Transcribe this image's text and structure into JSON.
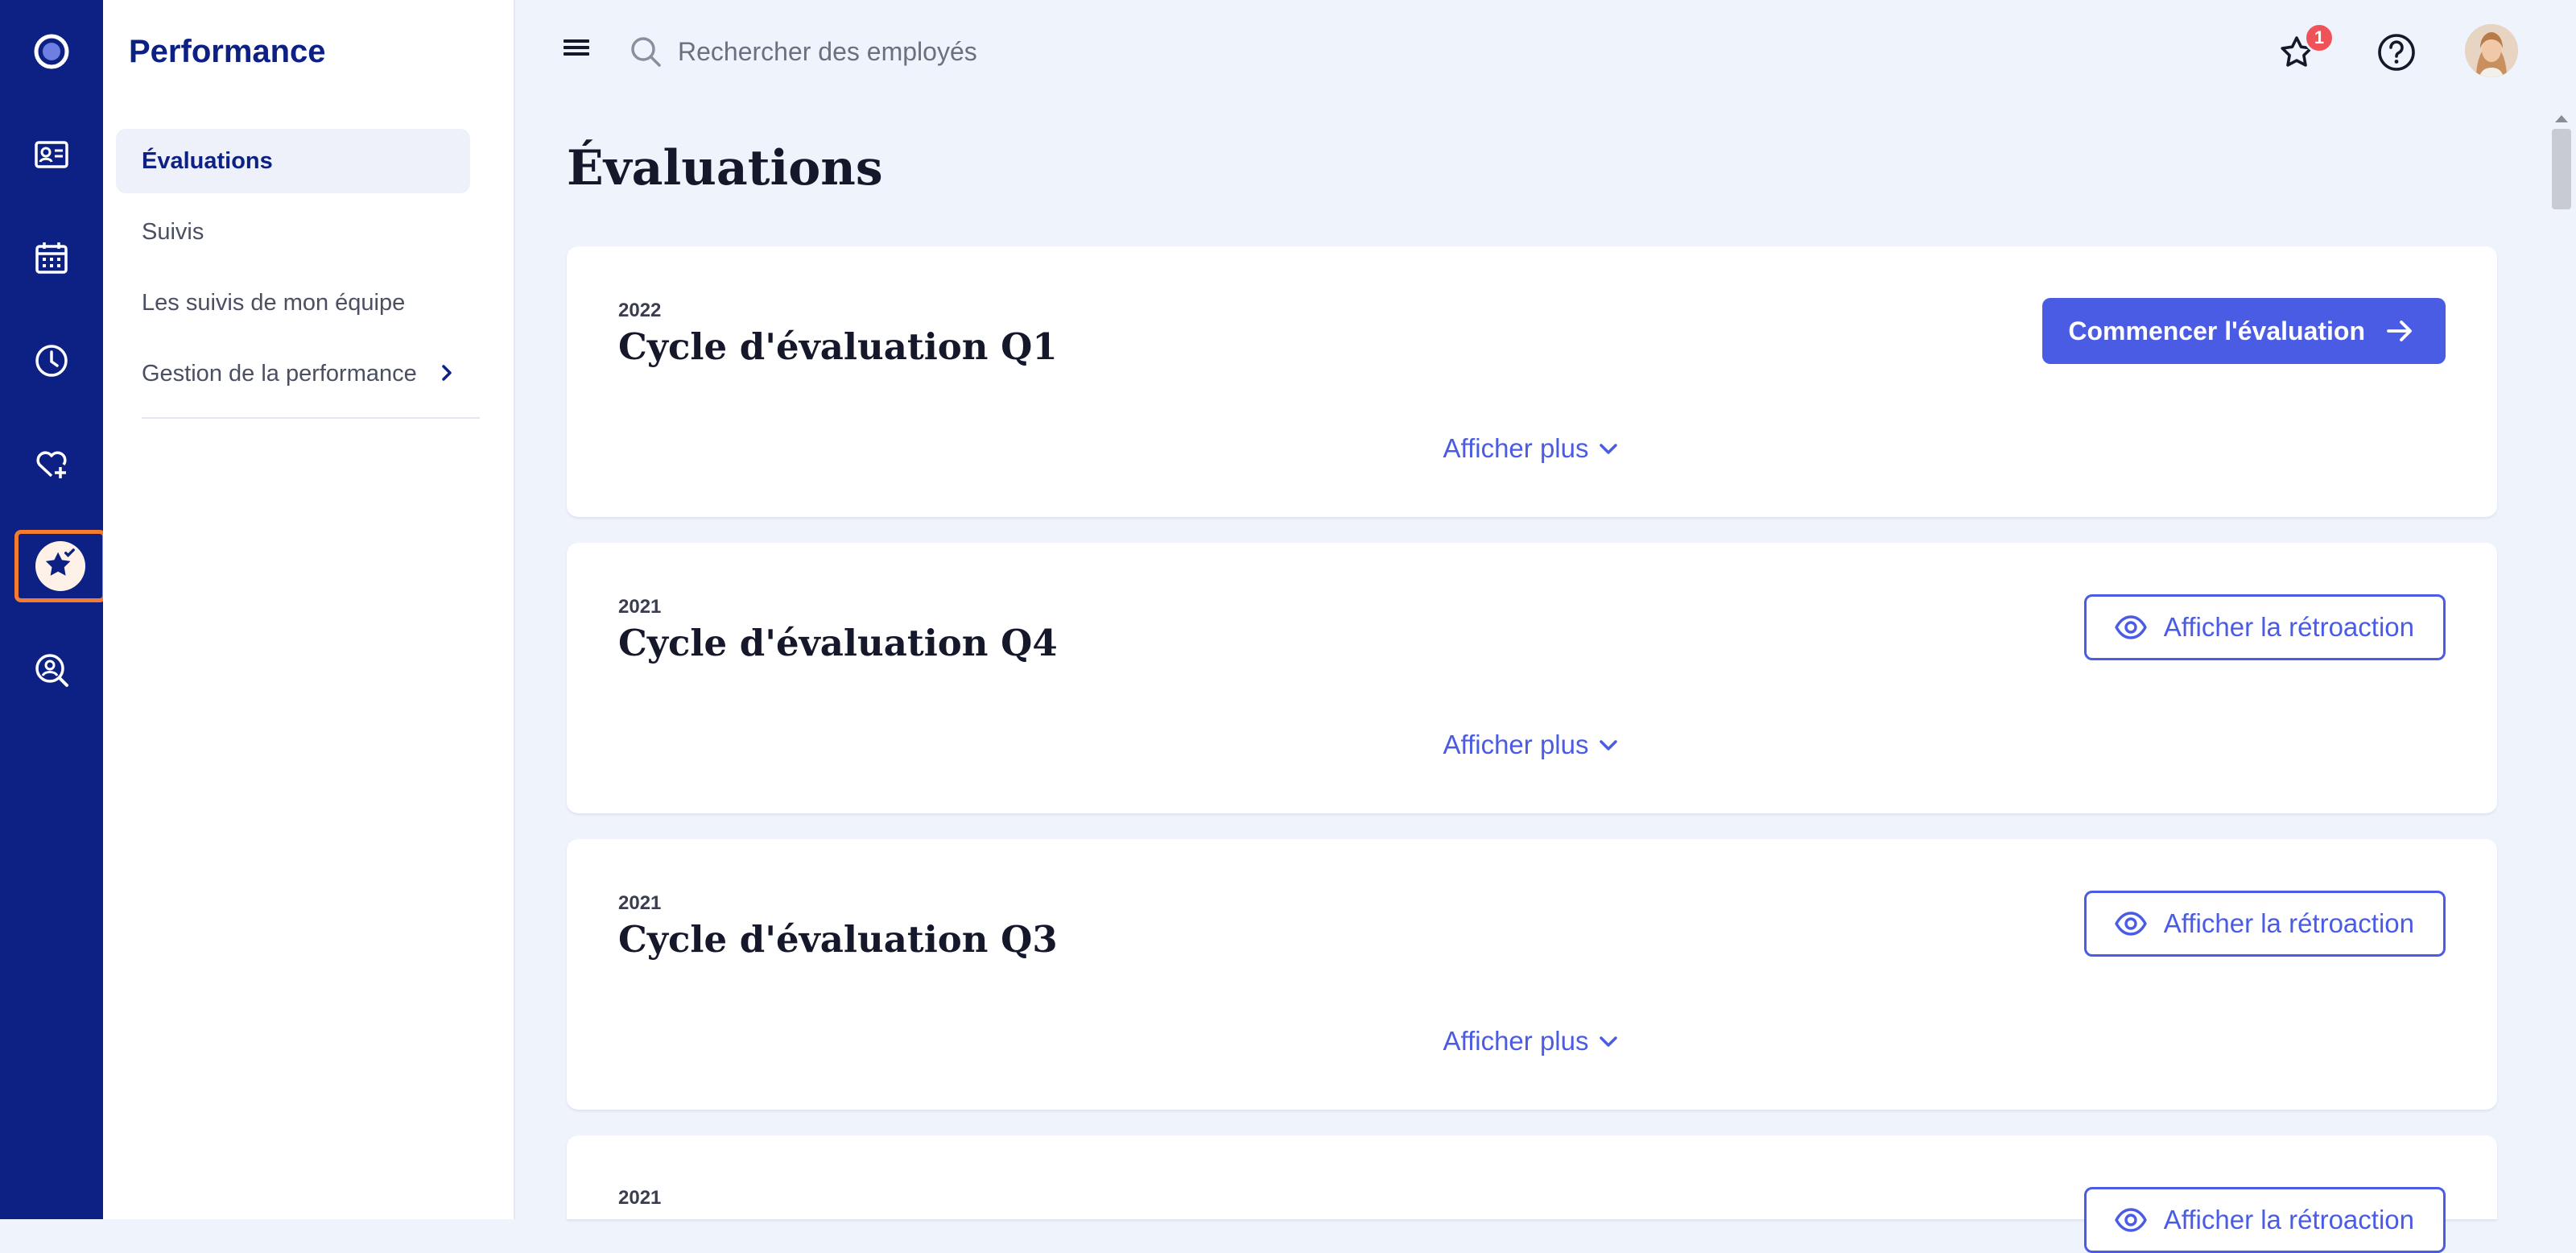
{
  "rail": {
    "items": [
      {
        "name": "logo-icon"
      },
      {
        "name": "id-card-icon"
      },
      {
        "name": "calendar-icon"
      },
      {
        "name": "clock-icon"
      },
      {
        "name": "heart-plus-icon"
      },
      {
        "name": "star-check-icon",
        "active": true
      },
      {
        "name": "search-user-icon"
      }
    ],
    "accent": "#f47b32",
    "background": "#0d2184"
  },
  "subnav": {
    "title": "Performance",
    "items": [
      {
        "label": "Évaluations",
        "active": true
      },
      {
        "label": "Suivis"
      },
      {
        "label": "Les suivis de mon équipe"
      },
      {
        "label": "Gestion de la performance",
        "has_submenu": true
      }
    ]
  },
  "topbar": {
    "search_placeholder": "Rechercher des employés",
    "notification_count": "1"
  },
  "main": {
    "title": "Évaluations",
    "cards": [
      {
        "year": "2022",
        "title": "Cycle d'évaluation Q1",
        "action": "Commencer l'évaluation",
        "action_type": "primary",
        "more": "Afficher plus"
      },
      {
        "year": "2021",
        "title": "Cycle d'évaluation Q4",
        "action": "Afficher la rétroaction",
        "action_type": "outline",
        "more": "Afficher plus"
      },
      {
        "year": "2021",
        "title": "Cycle d'évaluation Q3",
        "action": "Afficher la rétroaction",
        "action_type": "outline",
        "more": "Afficher plus"
      },
      {
        "year": "2021",
        "title": "",
        "action": "Afficher la rétroaction",
        "action_type": "outline",
        "more": ""
      }
    ]
  },
  "colors": {
    "primary": "#4b5ce4",
    "navy": "#0d2184",
    "page_bg": "#eff3fb",
    "badge": "#f0525a"
  }
}
